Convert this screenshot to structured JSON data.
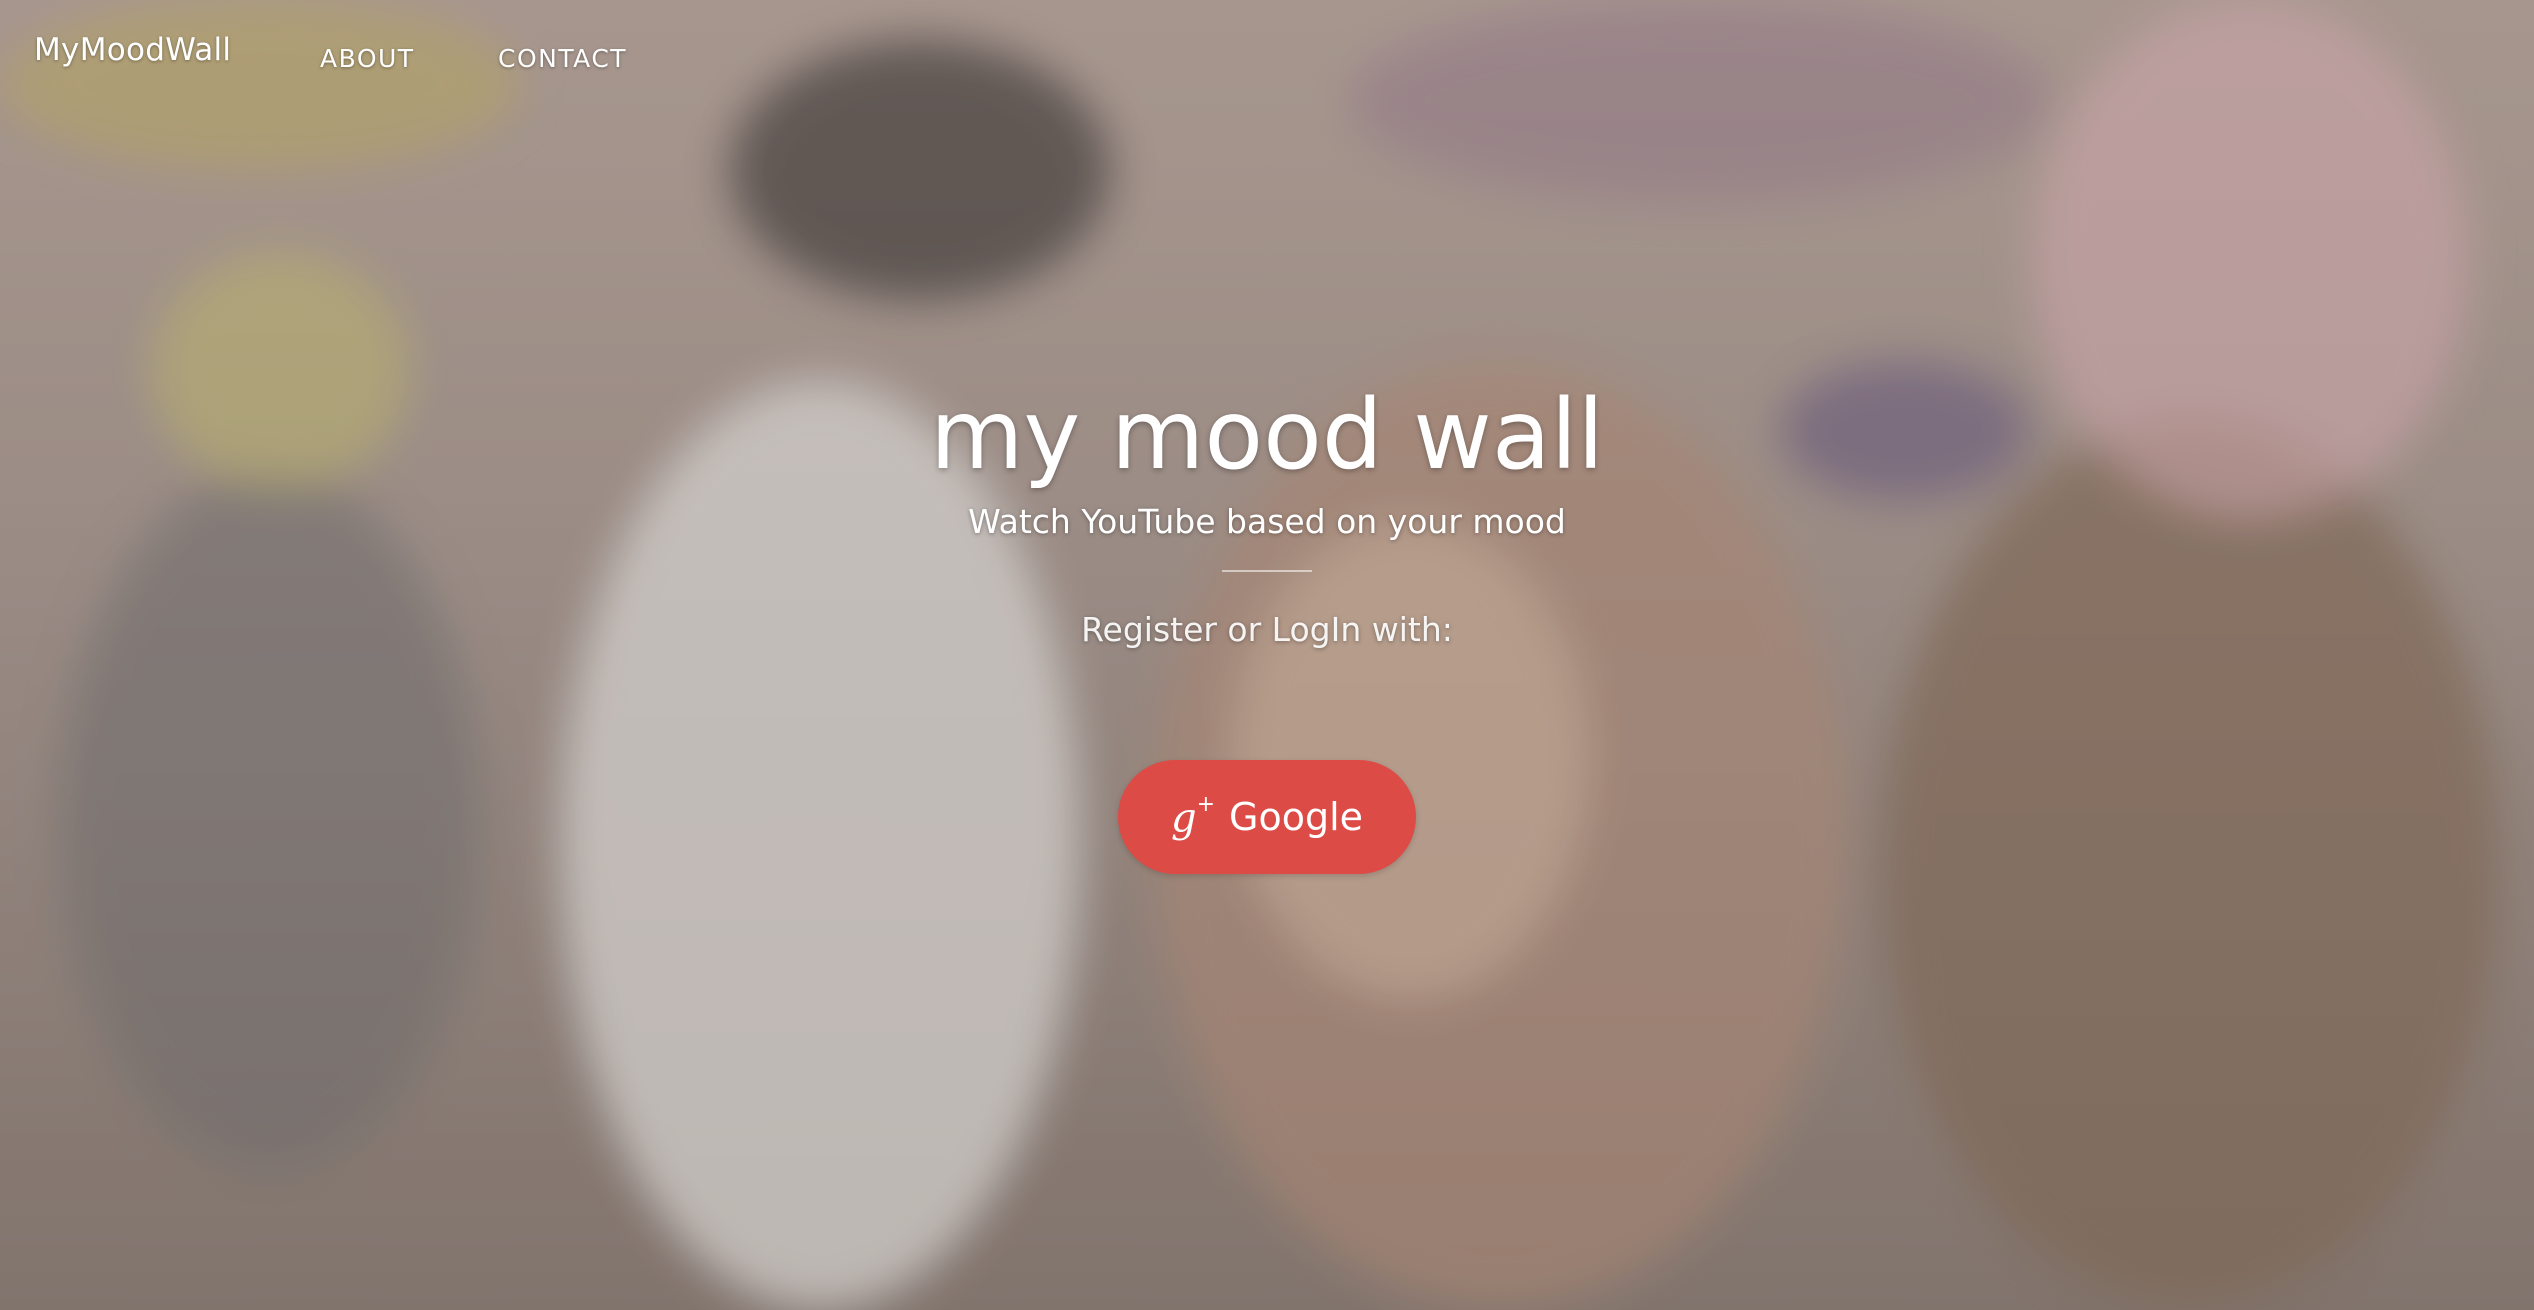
{
  "nav": {
    "brand": "MyMoodWall",
    "links": [
      {
        "label": "ABOUT"
      },
      {
        "label": "CONTACT"
      }
    ]
  },
  "hero": {
    "title": "my mood wall",
    "subtitle": "Watch YouTube based on your mood",
    "login_prompt": "Register or LogIn with:",
    "google_button": {
      "icon": "google-plus-icon",
      "label": "Google"
    }
  },
  "colors": {
    "google_button": "#dd4b46",
    "text": "#ffffff"
  }
}
